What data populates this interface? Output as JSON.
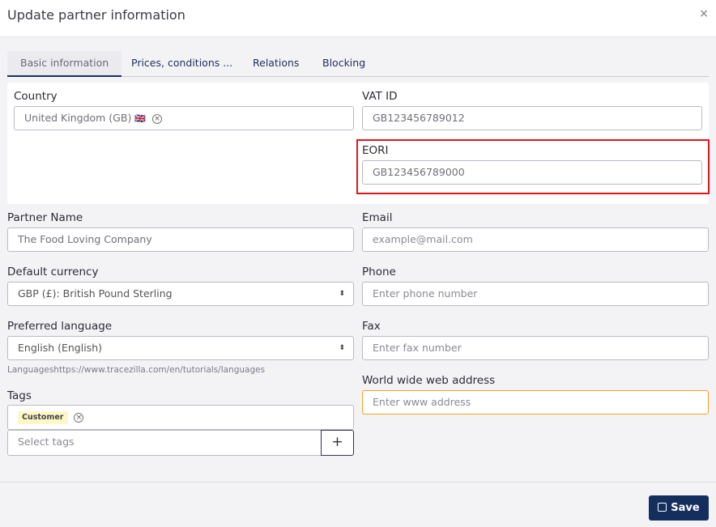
{
  "header": {
    "title": "Update partner information",
    "close": "×"
  },
  "tabs": [
    {
      "label": "Basic information"
    },
    {
      "label": "Prices, conditions ..."
    },
    {
      "label": "Relations"
    },
    {
      "label": "Blocking"
    }
  ],
  "form": {
    "country": {
      "label": "Country",
      "value": "United Kingdom (GB)",
      "flag": "🇬🇧"
    },
    "vat": {
      "label": "VAT ID",
      "value": "GB123456789012"
    },
    "eori": {
      "label": "EORI",
      "value": "GB123456789000"
    },
    "partner_name": {
      "label": "Partner Name",
      "value": "The Food Loving Company"
    },
    "email": {
      "label": "Email",
      "placeholder": "example@mail.com"
    },
    "currency": {
      "label": "Default currency",
      "value": "GBP (£): British Pound Sterling"
    },
    "phone": {
      "label": "Phone",
      "placeholder": "Enter phone number"
    },
    "language": {
      "label": "Preferred language",
      "value": "English (English)",
      "hint": "Languageshttps://www.tracezilla.com/en/tutorials/languages"
    },
    "fax": {
      "label": "Fax",
      "placeholder": "Enter fax number"
    },
    "www": {
      "label": "World wide web address",
      "placeholder": "Enter www address"
    },
    "tags": {
      "label": "Tags",
      "chips": [
        "Customer"
      ],
      "placeholder": "Select tags",
      "add": "+"
    }
  },
  "footer": {
    "save": "Save"
  },
  "colors": {
    "primary": "#142f5e",
    "highlight": "#e8141b",
    "focus": "#f0a020"
  }
}
